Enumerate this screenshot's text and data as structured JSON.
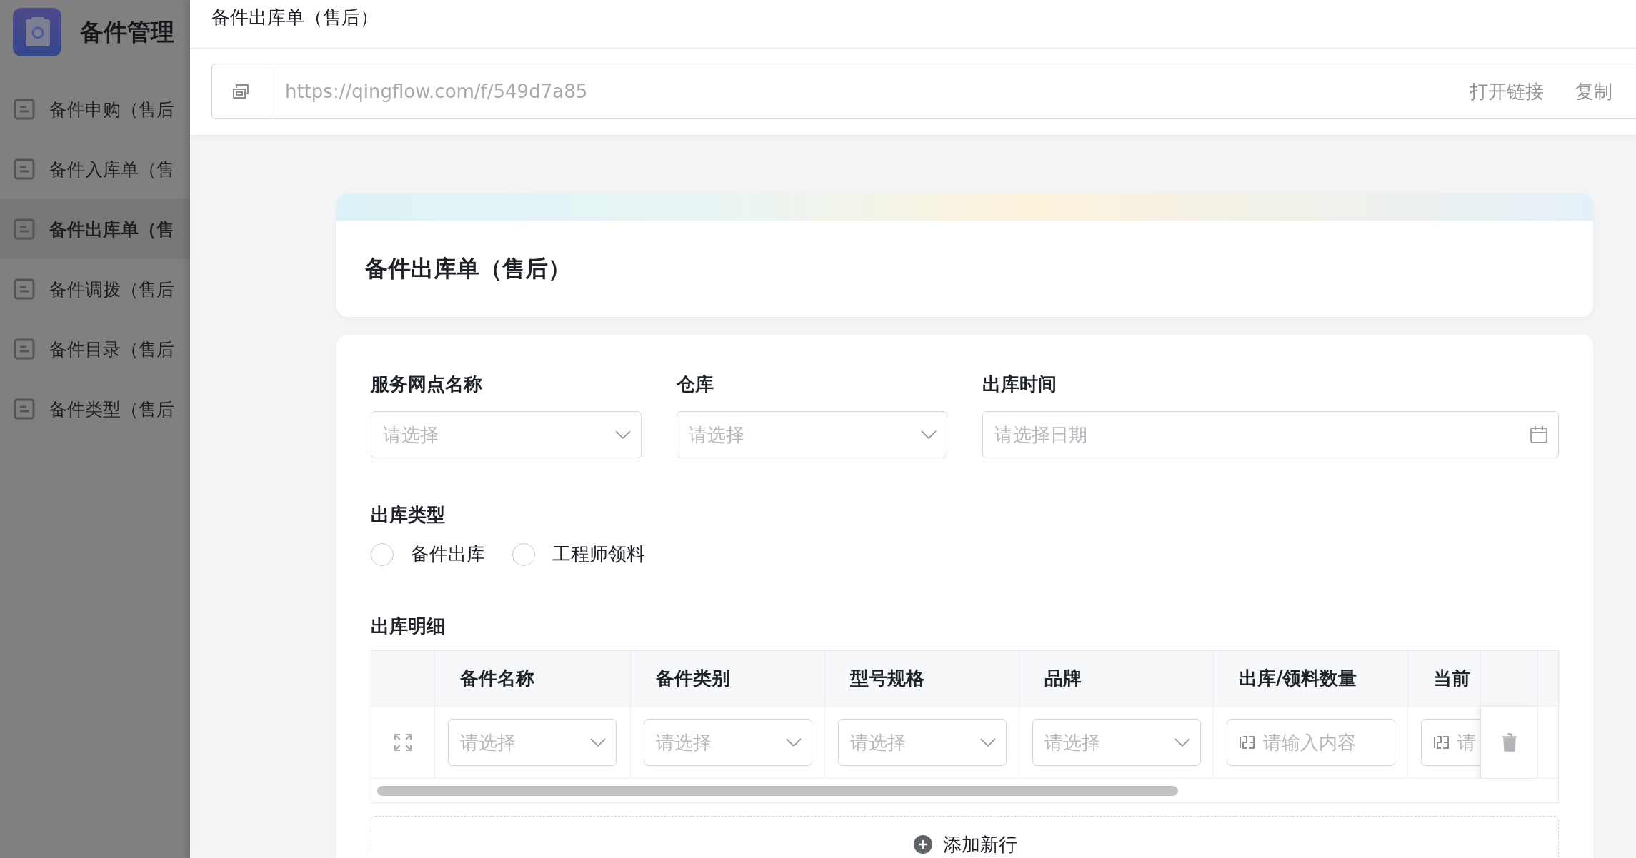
{
  "sidebar": {
    "app_title": "备件管理",
    "items": [
      {
        "label": "备件申购（售后",
        "selected": false
      },
      {
        "label": "备件入库单（售",
        "selected": false
      },
      {
        "label": "备件出库单（售",
        "selected": true
      },
      {
        "label": "备件调拨（售后",
        "selected": false
      },
      {
        "label": "备件目录（售后",
        "selected": false
      },
      {
        "label": "备件类型（售后",
        "selected": false
      }
    ]
  },
  "drawer": {
    "title": "备件出库单（售后）",
    "link": {
      "url": "https://qingflow.com/f/549d7a85",
      "actions": [
        "打开链接",
        "复制"
      ]
    }
  },
  "form": {
    "title": "备件出库单（售后）",
    "fields": [
      {
        "label": "服务网点名称",
        "kind": "select",
        "placeholder": "请选择"
      },
      {
        "label": "仓库",
        "kind": "select",
        "placeholder": "请选择"
      },
      {
        "label": "出库时间",
        "kind": "date",
        "placeholder": "请选择日期"
      }
    ],
    "radio_group": {
      "label": "出库类型",
      "options": [
        {
          "label": "备件出库",
          "selected": false
        },
        {
          "label": "工程师领料",
          "selected": false
        }
      ]
    },
    "detail_table": {
      "label": "出库明细",
      "columns": [
        "备件名称",
        "备件类别",
        "型号规格",
        "品牌",
        "出库/领料数量",
        "当前"
      ],
      "rows": [
        {
          "cells": [
            {
              "kind": "select",
              "placeholder": "请选择"
            },
            {
              "kind": "select",
              "placeholder": "请选择"
            },
            {
              "kind": "select",
              "placeholder": "请选择"
            },
            {
              "kind": "select",
              "placeholder": "请选择"
            },
            {
              "kind": "number",
              "placeholder": "请输入内容"
            },
            {
              "kind": "number",
              "placeholder": "请"
            }
          ]
        }
      ],
      "add_row": "添加新行"
    }
  }
}
